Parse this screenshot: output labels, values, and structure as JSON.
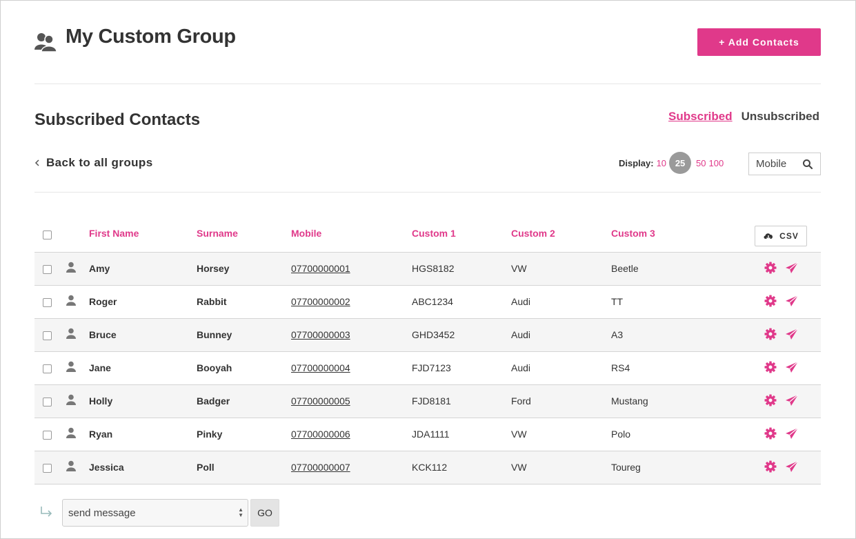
{
  "header": {
    "title": "My Custom Group",
    "add_button": "+ Add Contacts"
  },
  "section": {
    "title": "Subscribed Contacts",
    "tabs": {
      "subscribed": "Subscribed",
      "unsubscribed": "Unsubscribed"
    },
    "back_link": "Back to all groups"
  },
  "display": {
    "label": "Display:",
    "options": [
      "10",
      "25",
      "50",
      "100"
    ],
    "selected": "25"
  },
  "search": {
    "field": "Mobile"
  },
  "table": {
    "columns": {
      "first_name": "First Name",
      "surname": "Surname",
      "mobile": "Mobile",
      "custom1": "Custom 1",
      "custom2": "Custom 2",
      "custom3": "Custom 3"
    },
    "csv_label": "CSV",
    "rows": [
      {
        "first_name": "Amy",
        "surname": "Horsey",
        "mobile": "07700000001",
        "custom1": "HGS8182",
        "custom2": "VW",
        "custom3": "Beetle"
      },
      {
        "first_name": "Roger",
        "surname": "Rabbit",
        "mobile": "07700000002",
        "custom1": "ABC1234",
        "custom2": "Audi",
        "custom3": "TT"
      },
      {
        "first_name": "Bruce",
        "surname": "Bunney",
        "mobile": "07700000003",
        "custom1": "GHD3452",
        "custom2": "Audi",
        "custom3": "A3"
      },
      {
        "first_name": "Jane",
        "surname": "Booyah",
        "mobile": "07700000004",
        "custom1": "FJD7123",
        "custom2": "Audi",
        "custom3": "RS4"
      },
      {
        "first_name": "Holly",
        "surname": "Badger",
        "mobile": "07700000005",
        "custom1": "FJD8181",
        "custom2": "Ford",
        "custom3": "Mustang"
      },
      {
        "first_name": "Ryan",
        "surname": "Pinky",
        "mobile": "07700000006",
        "custom1": "JDA1111",
        "custom2": "VW",
        "custom3": "Polo"
      },
      {
        "first_name": "Jessica",
        "surname": "Poll",
        "mobile": "07700000007",
        "custom1": "KCK112",
        "custom2": "VW",
        "custom3": "Toureg"
      }
    ]
  },
  "bulk": {
    "action": "send message",
    "go": "GO"
  },
  "colors": {
    "accent": "#e0398a",
    "selected_badge": "#9a9a9a",
    "row_alt": "#f5f5f5"
  },
  "icons": [
    "group-icon",
    "chevron-left-icon",
    "search-icon",
    "cloud-download-icon",
    "person-icon",
    "gear-icon",
    "send-icon",
    "return-arrow-icon"
  ]
}
